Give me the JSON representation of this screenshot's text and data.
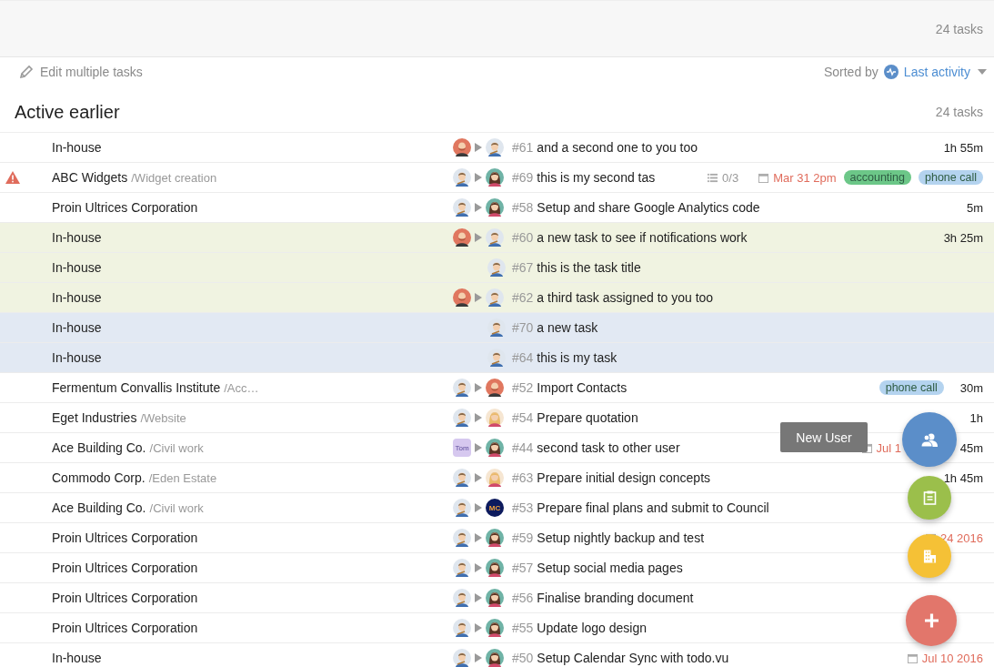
{
  "header": {
    "count": "24 tasks"
  },
  "toolbar": {
    "edit": "Edit multiple tasks",
    "sorted_by": "Sorted by",
    "sort": "Last activity"
  },
  "section": {
    "title": "Active earlier",
    "count": "24 tasks"
  },
  "rows": [
    {
      "project": "In-house",
      "from": {
        "kind": "bearded"
      },
      "to": {
        "kind": "guitarist"
      },
      "number": "#61",
      "title": "and a second one to you too",
      "time": "1h 55m"
    },
    {
      "warning": true,
      "project": "ABC Widgets",
      "sub": "/Widget creation",
      "from": {
        "kind": "guitarist"
      },
      "to": {
        "kind": "brunette"
      },
      "number": "#69",
      "title": "this is my second tas",
      "checklist": "0/3",
      "due": "Mar 31 2pm",
      "tags": [
        {
          "label": "accounting",
          "color": "#6cc788"
        },
        {
          "label": "phone call",
          "color": "#b4d3ef"
        }
      ]
    },
    {
      "project": "Proin Ultrices Corporation",
      "from": {
        "kind": "guitarist"
      },
      "to": {
        "kind": "brunette"
      },
      "number": "#58",
      "title": "Setup and share Google Analytics code",
      "time": "5m"
    },
    {
      "project": "In-house",
      "color": "#f0f3e1",
      "from": {
        "kind": "bearded"
      },
      "to": {
        "kind": "guitarist"
      },
      "number": "#60",
      "title": "a new task to see if notifications work",
      "time": "3h 25m"
    },
    {
      "project": "In-house",
      "color": "#f0f3e1",
      "to": {
        "kind": "guitarist"
      },
      "number": "#67",
      "title": "this is the task title"
    },
    {
      "project": "In-house",
      "color": "#f0f3e1",
      "from": {
        "kind": "bearded"
      },
      "to": {
        "kind": "guitarist"
      },
      "number": "#62",
      "title": "a third task assigned to you too"
    },
    {
      "project": "In-house",
      "color": "#e2e9f3",
      "to": {
        "kind": "guitarist"
      },
      "number": "#70",
      "title": "a new task"
    },
    {
      "project": "In-house",
      "color": "#e2e9f3",
      "to": {
        "kind": "guitarist"
      },
      "number": "#64",
      "title": "this is my task"
    },
    {
      "project": "Fermentum Convallis Institute",
      "sub": "/Acc…",
      "from": {
        "kind": "guitarist"
      },
      "to": {
        "kind": "bearded"
      },
      "number": "#52",
      "title": "Import Contacts",
      "tags": [
        {
          "label": "phone call",
          "color": "#b4d3ef"
        }
      ],
      "time": "30m"
    },
    {
      "project": "Eget Industries",
      "sub": "/Website",
      "from": {
        "kind": "guitarist"
      },
      "to": {
        "kind": "blonde"
      },
      "number": "#54",
      "title": "Prepare quotation",
      "time": "1h"
    },
    {
      "project": "Ace Building Co.",
      "sub": "/Civil work",
      "from": {
        "kind": "initials",
        "label": "Tom"
      },
      "to": {
        "kind": "brunette"
      },
      "number": "#44",
      "title": "second task to other user",
      "due": "Jul 1",
      "time": "45m"
    },
    {
      "project": "Commodo Corp.",
      "sub": "/Eden Estate",
      "from": {
        "kind": "guitarist"
      },
      "to": {
        "kind": "blonde"
      },
      "number": "#63",
      "title": "Prepare initial design concepts",
      "time": "1h 45m"
    },
    {
      "project": "Ace Building Co.",
      "sub": "/Civil work",
      "from": {
        "kind": "guitarist"
      },
      "to": {
        "kind": "initials",
        "label": "MC"
      },
      "number": "#53",
      "title": "Prepare final plans and submit to Council"
    },
    {
      "project": "Proin Ultrices Corporation",
      "from": {
        "kind": "guitarist"
      },
      "to": {
        "kind": "brunette"
      },
      "number": "#59",
      "title": "Setup nightly backup and test",
      "due": "24 2016"
    },
    {
      "project": "Proin Ultrices Corporation",
      "from": {
        "kind": "guitarist"
      },
      "to": {
        "kind": "brunette"
      },
      "number": "#57",
      "title": "Setup social media pages"
    },
    {
      "project": "Proin Ultrices Corporation",
      "from": {
        "kind": "guitarist"
      },
      "to": {
        "kind": "brunette"
      },
      "number": "#56",
      "title": "Finalise branding document"
    },
    {
      "project": "Proin Ultrices Corporation",
      "from": {
        "kind": "guitarist"
      },
      "to": {
        "kind": "brunette"
      },
      "number": "#55",
      "title": "Update logo design"
    },
    {
      "project": "In-house",
      "from": {
        "kind": "guitarist"
      },
      "to": {
        "kind": "brunette"
      },
      "number": "#50",
      "title": "Setup Calendar Sync with todo.vu",
      "due": "Jul 10 2016"
    }
  ],
  "fab_menu": {
    "tooltip": "New User",
    "actions": [
      {
        "kind": "users",
        "color": "#5b8ec9"
      },
      {
        "kind": "task",
        "color": "#9bbf4b"
      },
      {
        "kind": "company",
        "color": "#f5c136"
      },
      {
        "kind": "add",
        "color": "#e2766b"
      }
    ]
  }
}
